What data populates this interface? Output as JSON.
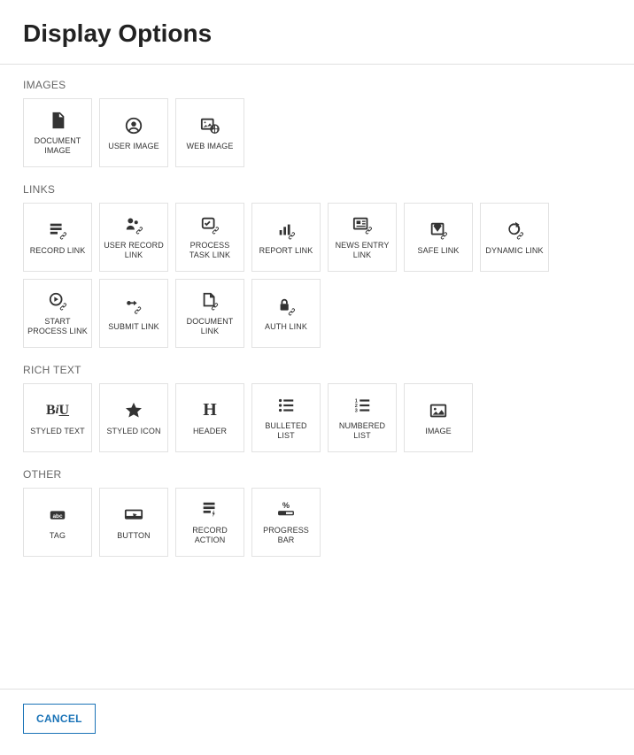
{
  "title": "Display Options",
  "sections": {
    "images": {
      "header": "IMAGES",
      "items": [
        {
          "label": "DOCUMENT IMAGE",
          "icon": "document-image-icon"
        },
        {
          "label": "USER IMAGE",
          "icon": "user-image-icon"
        },
        {
          "label": "WEB IMAGE",
          "icon": "web-image-icon"
        }
      ]
    },
    "links": {
      "header": "LINKS",
      "items": [
        {
          "label": "RECORD LINK",
          "icon": "record-link-icon"
        },
        {
          "label": "USER RECORD LINK",
          "icon": "user-record-link-icon"
        },
        {
          "label": "PROCESS TASK LINK",
          "icon": "process-task-link-icon"
        },
        {
          "label": "REPORT LINK",
          "icon": "report-link-icon"
        },
        {
          "label": "NEWS ENTRY LINK",
          "icon": "news-entry-link-icon"
        },
        {
          "label": "SAFE LINK",
          "icon": "safe-link-icon"
        },
        {
          "label": "DYNAMIC LINK",
          "icon": "dynamic-link-icon"
        },
        {
          "label": "START PROCESS LINK",
          "icon": "start-process-link-icon"
        },
        {
          "label": "SUBMIT LINK",
          "icon": "submit-link-icon"
        },
        {
          "label": "DOCUMENT LINK",
          "icon": "document-link-icon"
        },
        {
          "label": "AUTH LINK",
          "icon": "auth-link-icon"
        }
      ]
    },
    "richtext": {
      "header": "RICH TEXT",
      "items": [
        {
          "label": "STYLED TEXT",
          "icon": "styled-text-icon"
        },
        {
          "label": "STYLED ICON",
          "icon": "styled-icon-icon"
        },
        {
          "label": "HEADER",
          "icon": "header-icon"
        },
        {
          "label": "BULLETED LIST",
          "icon": "bulleted-list-icon"
        },
        {
          "label": "NUMBERED LIST",
          "icon": "numbered-list-icon"
        },
        {
          "label": "IMAGE",
          "icon": "image-icon"
        }
      ]
    },
    "other": {
      "header": "OTHER",
      "items": [
        {
          "label": "TAG",
          "icon": "tag-icon"
        },
        {
          "label": "BUTTON",
          "icon": "button-icon"
        },
        {
          "label": "RECORD ACTION",
          "icon": "record-action-icon"
        },
        {
          "label": "PROGRESS BAR",
          "icon": "progress-bar-icon"
        }
      ]
    }
  },
  "footer": {
    "cancel_label": "CANCEL"
  }
}
